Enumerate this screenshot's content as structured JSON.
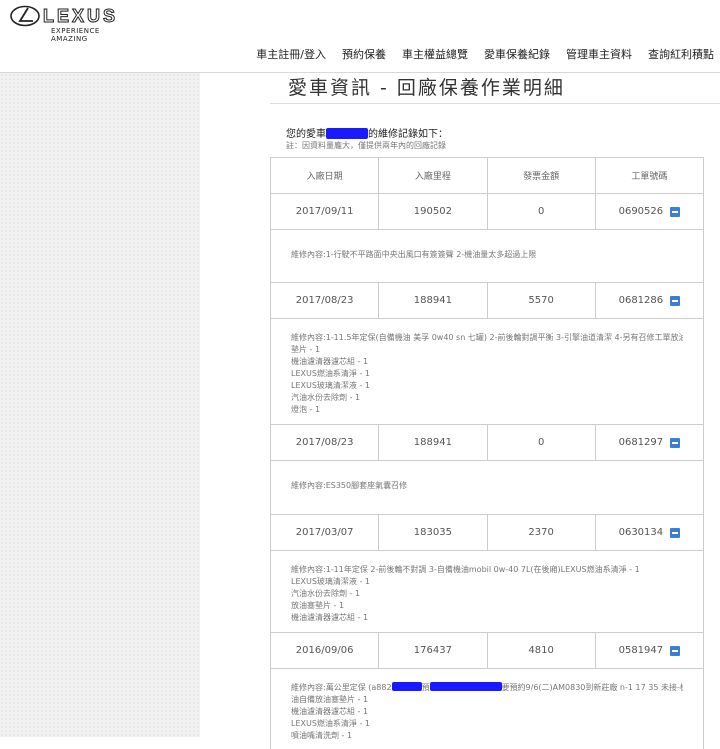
{
  "brand": {
    "wordmark": "LEXUS",
    "tagline": "EXPERIENCE AMAZING"
  },
  "nav": [
    "車主註冊/登入",
    "預約保養",
    "車主權益總覽",
    "愛車保養紀錄",
    "管理車主資料",
    "查詢紅利積點"
  ],
  "page": {
    "title": "愛車資訊 - 回廠保養作業明細",
    "intro_prefix": "您的愛車",
    "intro_suffix": "的維修記錄如下：",
    "note": "註：因資料量龐大，僅提供兩年內的回廠記錄"
  },
  "table": {
    "headers": [
      "入廠日期",
      "入廠里程",
      "發票金額",
      "工單號碼"
    ],
    "records": [
      {
        "date": "2017/09/11",
        "mileage": "190502",
        "amount": "0",
        "order": "0690526",
        "detail": [
          "維修內容:1-行駛不平路面中央出風口有簽簽聲 2-機油量太多超過上限"
        ]
      },
      {
        "date": "2017/08/23",
        "mileage": "188941",
        "amount": "5570",
        "order": "0681286",
        "detail": [
          "維修內容:1-11.5年定保(自備機油 美孚 0w40 sn 七罐) 2-前後輪對調平衡 3-引擎油道清潔 4-另有召修工單放油塞",
          "墊片 - 1",
          "機油濾清器濾芯組 - 1",
          "LEXUS燃油系清淨 - 1",
          "LEXUS玻璃清潔液 - 1",
          "汽油水份去除劑 - 1",
          "燈泡 - 1"
        ]
      },
      {
        "date": "2017/08/23",
        "mileage": "188941",
        "amount": "0",
        "order": "0681297",
        "detail": [
          "維修內容:ES350腳套座氣囊召修"
        ]
      },
      {
        "date": "2017/03/07",
        "mileage": "183035",
        "amount": "2370",
        "order": "0630134",
        "detail": [
          "維修內容:1-11年定保 2-前後輪不對調 3-自備機油mobil 0w-40 7L(在後廂)LEXUS燃油系清淨 - 1",
          "LEXUS玻璃清潔液 - 1",
          "汽油水份去除劑 - 1",
          "放油塞墊片 - 1",
          "機油濾清器濾芯組 - 1"
        ]
      },
      {
        "date": "2016/09/06",
        "mileage": "176437",
        "amount": "4810",
        "order": "0581947",
        "detail_first": {
          "start": "維修內容:萬公里定保 (a882",
          "mid": "預",
          "end": "要預約9/6(二)AM0830到新莊廠 n-1 17 35 未接-機"
        },
        "detail": [
          "油自備放油塞墊片 - 1",
          "機油濾清器濾芯組 - 1",
          "LEXUS燃油系清淨 - 1",
          "噴油嘴清洗劑 - 1"
        ]
      }
    ]
  }
}
